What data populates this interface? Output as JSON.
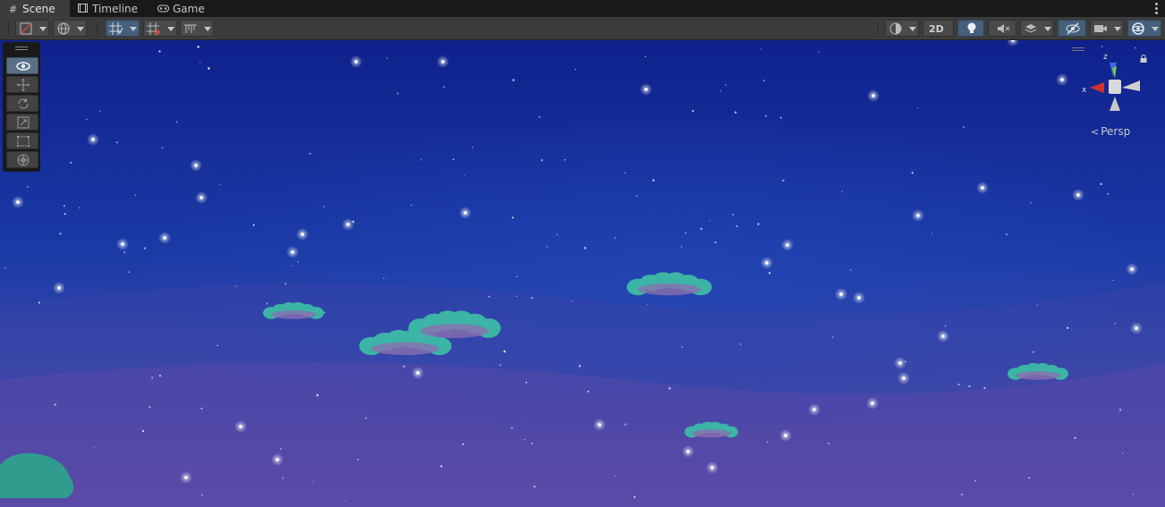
{
  "tabs": [
    {
      "label": "Scene",
      "icon": "grid-icon",
      "active": true
    },
    {
      "label": "Timeline",
      "icon": "film-icon",
      "active": false
    },
    {
      "label": "Game",
      "icon": "gamepad-icon",
      "active": false
    }
  ],
  "toolbar": {
    "two_d_label": "2D",
    "left_buttons": [
      "draw-mode-shaded",
      "global-pivot",
      "grid-snapping",
      "increment-snap",
      "snap-settings"
    ],
    "right_buttons": [
      "shading-sphere",
      "2d-toggle",
      "lighting-toggle",
      "audio-toggle",
      "effects-layers",
      "hidden-objects-toggle",
      "camera-settings",
      "gizmos-toggle"
    ]
  },
  "tools": [
    {
      "name": "view-tool",
      "icon": "eye-icon",
      "active": true
    },
    {
      "name": "move-tool",
      "icon": "move-icon",
      "active": false
    },
    {
      "name": "rotate-tool",
      "icon": "rotate-icon",
      "active": false
    },
    {
      "name": "scale-tool",
      "icon": "scale-icon",
      "active": false
    },
    {
      "name": "rect-tool",
      "icon": "rect-icon",
      "active": false
    },
    {
      "name": "transform-tool",
      "icon": "transform-icon",
      "active": false
    }
  ],
  "gizmo": {
    "x_label": "x",
    "z_label": "z",
    "projection_label": "Persp"
  },
  "colors": {
    "sky_top": "#0f1f8c",
    "sky_mid": "#1e3aaa",
    "sky_bottom": "#6a4ea8",
    "cloud": "#3fb8a8",
    "accent": "#46607c"
  }
}
